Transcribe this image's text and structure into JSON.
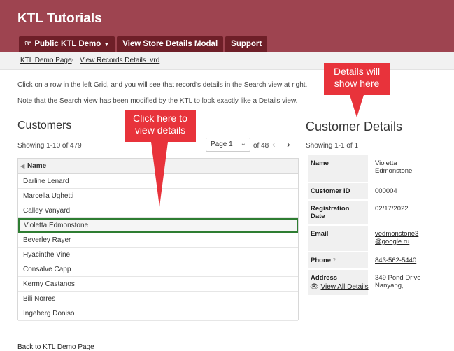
{
  "app": {
    "title": "KTL Tutorials"
  },
  "nav": [
    {
      "label": "Public KTL Demo",
      "icon": "hand-pointer-icon",
      "has_dropdown": true
    },
    {
      "label": "View Store Details Modal"
    },
    {
      "label": "Support"
    }
  ],
  "breadcrumb": {
    "home": "KTL Demo Page",
    "current": "View Records Details_vrd"
  },
  "intro": {
    "line1": "Click on a row in the left Grid, and you will see that record's details in the Search view at right.",
    "line2": "Note that the Search view has been modified by the KTL to look exactly like a Details view."
  },
  "customers": {
    "title": "Customers",
    "showing": "Showing 1-10 of 479",
    "page_select": "Page 1",
    "page_total": "of 48",
    "column": "Name",
    "rows": [
      "Darline Lenard",
      "Marcella Ughetti",
      "Calley Vanyard",
      "Violetta Edmonstone",
      "Beverley Rayer",
      "Hyacinthe Vine",
      "Consalve Capp",
      "Kermy Castanos",
      "Bili Norres",
      "Ingeberg Doniso"
    ],
    "selected_row": "Violetta Edmonstone"
  },
  "details": {
    "title": "Customer Details",
    "showing": "Showing 1-1 of 1",
    "name_label": "Name",
    "name_line1": "Violetta",
    "name_line2": "Edmonstone",
    "id_label": "Customer ID",
    "id_value": "000004",
    "reg_label": "Registration Date",
    "reg_value": "02/17/2022",
    "email_label": "Email",
    "email_line1": "vedmonstone3",
    "email_line2": "@google.ru",
    "phone_label": "Phone",
    "phone_value": "843-562-5440",
    "address_label": "Address",
    "address_line1": "349 Pond Drive",
    "address_line2": "Nanyang,",
    "view_all": "View All Details"
  },
  "callouts": {
    "left_line1": "Click here to",
    "left_line2": "view details",
    "right_line1": "Details will",
    "right_line2": "show here"
  },
  "footer": {
    "back": "Back to KTL Demo Page"
  },
  "colors": {
    "header": "#9e4450",
    "nav": "#6e1f28",
    "callout": "#e8333b",
    "selected_border": "#2e7d32"
  }
}
